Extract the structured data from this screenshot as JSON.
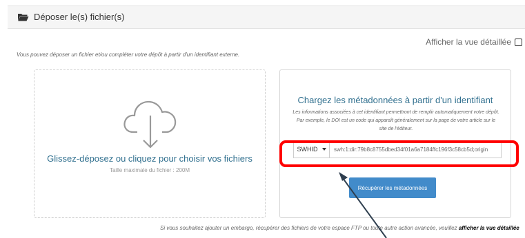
{
  "panel": {
    "title": "Déposer le(s) fichier(s)",
    "icon": "folder-open-icon"
  },
  "detailed_view": {
    "label": "Afficher la vue détaillée",
    "checked": false
  },
  "intro": "Vous pouvez déposer un fichier et/ou compléter votre dépôt à partir d'un identifiant externe.",
  "dropzone": {
    "title": "Glissez-déposez ou cliquez pour choisir vos fichiers",
    "subtitle": "Taille maximale du fichier : 200M",
    "icon": "cloud-download-icon"
  },
  "metadata": {
    "title": "Chargez les métadonnées à partir d'un identifiant",
    "description": "Les informations associées à cet identifiant permettront de remplir automatiquement votre dépôt. Par exemple, le DOI est un code qui apparaît généralement sur la page de votre article sur le site de l'éditeur.",
    "id_type": "SWHID",
    "id_value": "swh:1:dir:79b8c8755dbed34f01a6a7184ffc196f3c58cb5d;origin",
    "fetch_label": "Récupérer les métadonnées"
  },
  "footer": {
    "text": "Si vous souhaitez ajouter un embargo, récupérer des fichiers de votre espace FTP ou toute autre action avancée, veuillez ",
    "link": "afficher la vue détaillée"
  },
  "colors": {
    "accent": "#428bca",
    "title_blue": "#31708f",
    "highlight": "#ff0000"
  }
}
